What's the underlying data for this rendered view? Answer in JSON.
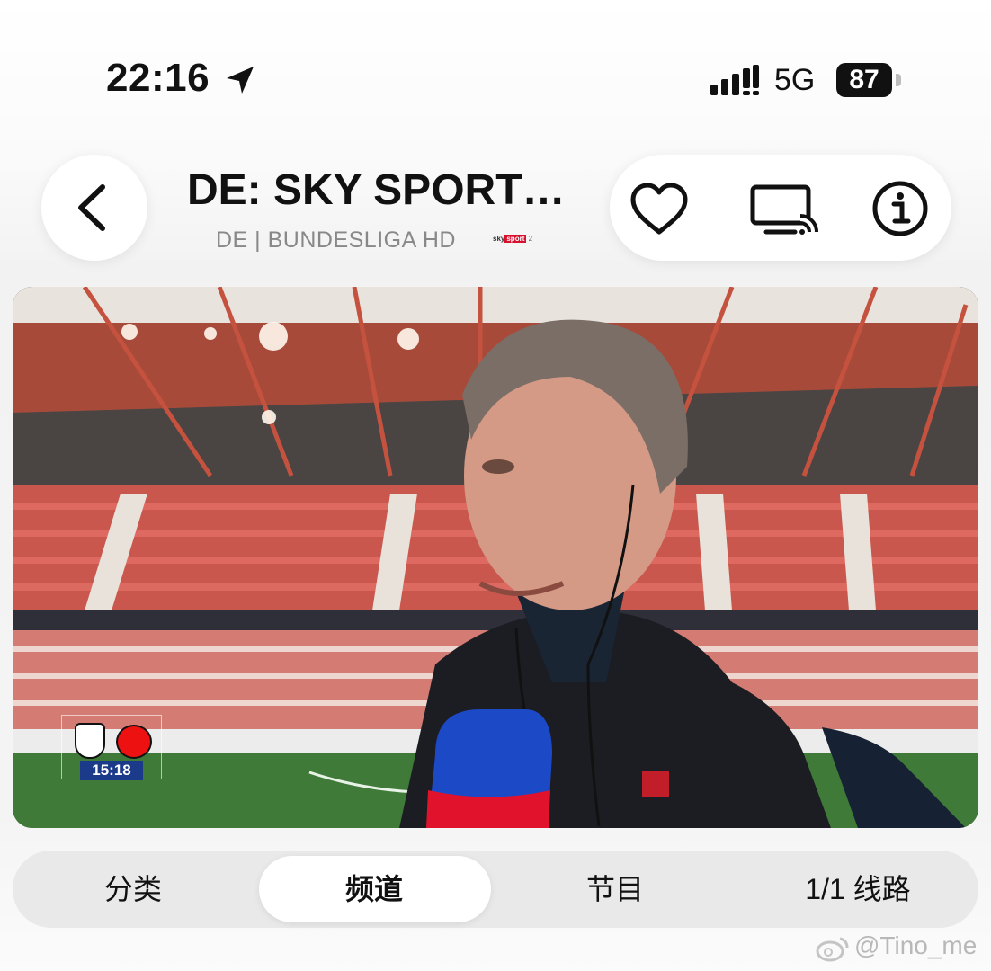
{
  "status_bar": {
    "time": "22:16",
    "network": "5G",
    "battery": "87"
  },
  "header": {
    "title": "DE: SKY SPORT…",
    "subtitle": "DE | BUNDESLIGA HD",
    "channel_logo": {
      "sky": "sky",
      "sport": "sport",
      "suffix": "2"
    }
  },
  "icons": {
    "back": "chevron-left-icon",
    "favorite": "heart-icon",
    "cast": "cast-icon",
    "info": "info-icon",
    "location": "location-arrow-icon"
  },
  "video": {
    "scoreboard_time": "15:18"
  },
  "tabs": [
    {
      "label": "分类",
      "active": false
    },
    {
      "label": "频道",
      "active": true
    },
    {
      "label": "节目",
      "active": false
    },
    {
      "label": "1/1 线路",
      "active": false
    }
  ],
  "watermark": "@Tino_me",
  "colors": {
    "accent": "#111111",
    "tab_bar_bg": "#e9e9e9",
    "sky_red": "#d6102d",
    "scoreboard_blue": "#1b3a8a"
  }
}
